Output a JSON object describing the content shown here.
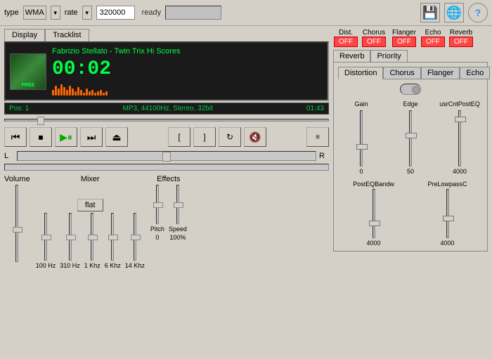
{
  "toolbar": {
    "type_label": "type",
    "format_value": "WMA",
    "rate_label": "rate",
    "rate_value": "320000",
    "status": "ready",
    "save_label": "💾",
    "globe_label": "🌐",
    "help_label": "?"
  },
  "tabs": {
    "display": "Display",
    "tracklist": "Tracklist"
  },
  "player": {
    "track_title": "Fabrizio Stellato - Twin Trix Hi Scores",
    "time": "00:02",
    "pos_label": "Pos: 1",
    "format_info": "MP3, 44100Hz, Stereo, 32bit",
    "duration": "01:43",
    "album_label": "FREE"
  },
  "controls": {
    "volume_label": "Volume",
    "mixer_label": "Mixer",
    "flat_btn": "flat",
    "effects_label": "Effects",
    "pitch_label": "Pitch",
    "speed_label": "Speed",
    "balance_left": "L",
    "balance_right": "R",
    "freq_labels": [
      "100 Hz",
      "310 Hz",
      "1 Khz",
      "6 Khz",
      "14 Khz"
    ],
    "pitch_value": "0",
    "speed_value": "100%"
  },
  "effects": {
    "dist_label": "Dist.",
    "chorus_label": "Chorus",
    "flanger_label": "Flanger",
    "echo_label": "Echo",
    "reverb_label": "Reverb",
    "dist_off": "OFF",
    "chorus_off": "OFF",
    "flanger_off": "OFF",
    "echo_off": "OFF",
    "reverb_off": "OFF",
    "tab_reverb": "Reverb",
    "tab_priority": "Priority",
    "subtab_distortion": "Distortion",
    "subtab_chorus": "Chorus",
    "subtab_flanger": "Flanger",
    "subtab_echo": "Echo",
    "sliders": {
      "gain_label": "Gain",
      "edge_label": "Edge",
      "usr_label": "usrCntPostEQ",
      "gain_value": "0",
      "edge_value": "50",
      "usr_value": "4000",
      "posteq_label": "PostEQBandw",
      "prelowpass_label": "PreLowpassC",
      "posteq_value": "4000",
      "prelowpass_value": "4000"
    }
  }
}
